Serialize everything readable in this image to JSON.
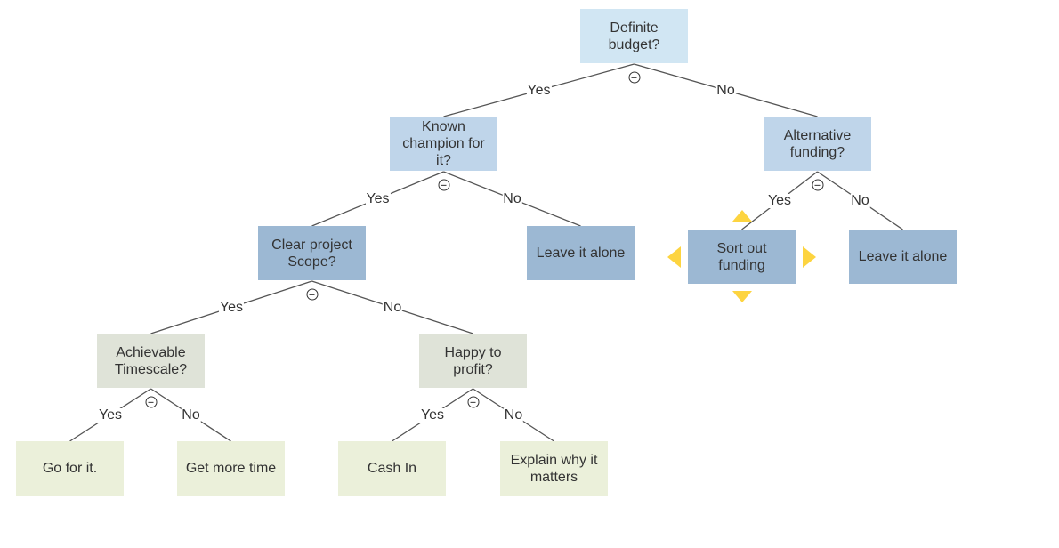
{
  "diagram": {
    "type": "decision-tree",
    "colors": {
      "level0": "#d1e6f3",
      "level1": "#bfd5ea",
      "level2": "#9cb8d3",
      "level3": "#dfe3d8",
      "level4": "#ebf0da",
      "edge": "#555555",
      "text": "#333333",
      "selection_handle": "#fdd440"
    },
    "nodes": [
      {
        "id": "definite-budget",
        "lines": [
          "Definite",
          "budget?"
        ],
        "level": 0
      },
      {
        "id": "known-champion",
        "lines": [
          "Known",
          "champion for it?"
        ],
        "level": 1
      },
      {
        "id": "alternative-funding",
        "lines": [
          "Alternative",
          "funding?"
        ],
        "level": 1
      },
      {
        "id": "clear-scope",
        "lines": [
          "Clear project",
          "Scope?"
        ],
        "level": 2
      },
      {
        "id": "leave-alone-1",
        "lines": [
          "Leave it alone"
        ],
        "level": 2
      },
      {
        "id": "sort-funding",
        "lines": [
          "Sort out",
          "funding"
        ],
        "level": 2,
        "selected": true
      },
      {
        "id": "leave-alone-2",
        "lines": [
          "Leave it alone"
        ],
        "level": 2
      },
      {
        "id": "achievable-timescale",
        "lines": [
          "Achievable",
          "Timescale?"
        ],
        "level": 3
      },
      {
        "id": "happy-profit",
        "lines": [
          "Happy to",
          "profit?"
        ],
        "level": 3
      },
      {
        "id": "go-for-it",
        "lines": [
          "Go for it."
        ],
        "level": 4
      },
      {
        "id": "get-more-time",
        "lines": [
          "Get more time"
        ],
        "level": 4
      },
      {
        "id": "cash-in",
        "lines": [
          "Cash In"
        ],
        "level": 4
      },
      {
        "id": "explain-why",
        "lines": [
          "Explain why it",
          "matters"
        ],
        "level": 4
      }
    ],
    "edges": [
      {
        "from": "definite-budget",
        "to": "known-champion",
        "label": "Yes"
      },
      {
        "from": "definite-budget",
        "to": "alternative-funding",
        "label": "No"
      },
      {
        "from": "known-champion",
        "to": "clear-scope",
        "label": "Yes"
      },
      {
        "from": "known-champion",
        "to": "leave-alone-1",
        "label": "No"
      },
      {
        "from": "alternative-funding",
        "to": "sort-funding",
        "label": "Yes"
      },
      {
        "from": "alternative-funding",
        "to": "leave-alone-2",
        "label": "No"
      },
      {
        "from": "clear-scope",
        "to": "achievable-timescale",
        "label": "Yes"
      },
      {
        "from": "clear-scope",
        "to": "happy-profit",
        "label": "No"
      },
      {
        "from": "achievable-timescale",
        "to": "go-for-it",
        "label": "Yes"
      },
      {
        "from": "achievable-timescale",
        "to": "get-more-time",
        "label": "No"
      },
      {
        "from": "happy-profit",
        "to": "cash-in",
        "label": "Yes"
      },
      {
        "from": "happy-profit",
        "to": "explain-why",
        "label": "No"
      }
    ],
    "collapse_icon": "minus-circle-icon"
  }
}
